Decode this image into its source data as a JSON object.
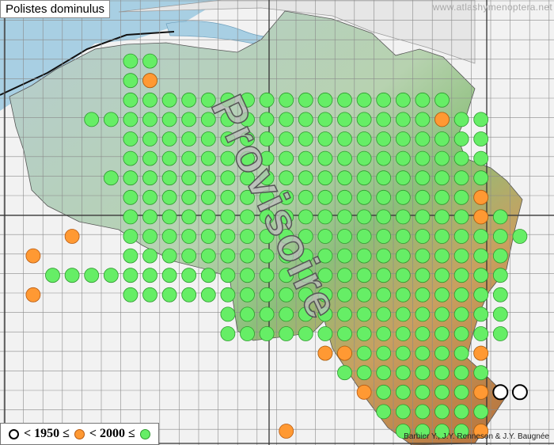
{
  "map": {
    "title": "Polistes dominulus",
    "website": "www.atlashymenoptera.net",
    "watermark": "Provisoire",
    "credit": "Barbier Y., J.Y. Renneson & J.Y. Baugnée"
  },
  "legend": {
    "label_1950": "< 1950 ≤",
    "label_2000": "< 2000 ≤"
  },
  "colors": {
    "green_record": "#66ee66",
    "orange_record": "#ff9933",
    "old_record_outline": "#000000",
    "water": "#9dc6de",
    "lowland": "#a9c4c8",
    "highland": "#c98a4e"
  },
  "records": {
    "green": [
      [
        3,
        6
      ],
      [
        3,
        7
      ],
      [
        4,
        6
      ],
      [
        4,
        7
      ],
      [
        5,
        6
      ],
      [
        5,
        7
      ],
      [
        5,
        8
      ],
      [
        5,
        9
      ],
      [
        5,
        10
      ],
      [
        5,
        11
      ],
      [
        5,
        12
      ],
      [
        5,
        13
      ],
      [
        5,
        14
      ],
      [
        5,
        15
      ],
      [
        5,
        16
      ],
      [
        5,
        17
      ],
      [
        5,
        18
      ],
      [
        5,
        19
      ],
      [
        5,
        20
      ],
      [
        5,
        21
      ],
      [
        5,
        22
      ],
      [
        6,
        4
      ],
      [
        6,
        5
      ],
      [
        6,
        6
      ],
      [
        6,
        7
      ],
      [
        6,
        8
      ],
      [
        6,
        9
      ],
      [
        6,
        10
      ],
      [
        6,
        11
      ],
      [
        6,
        12
      ],
      [
        6,
        13
      ],
      [
        6,
        14
      ],
      [
        6,
        15
      ],
      [
        6,
        16
      ],
      [
        6,
        17
      ],
      [
        6,
        18
      ],
      [
        6,
        19
      ],
      [
        6,
        20
      ],
      [
        6,
        21
      ],
      [
        6,
        22
      ],
      [
        6,
        23
      ],
      [
        6,
        24
      ],
      [
        7,
        6
      ],
      [
        7,
        7
      ],
      [
        7,
        8
      ],
      [
        7,
        9
      ],
      [
        7,
        10
      ],
      [
        7,
        11
      ],
      [
        7,
        12
      ],
      [
        7,
        13
      ],
      [
        7,
        14
      ],
      [
        7,
        15
      ],
      [
        7,
        16
      ],
      [
        7,
        17
      ],
      [
        7,
        18
      ],
      [
        7,
        19
      ],
      [
        7,
        20
      ],
      [
        7,
        21
      ],
      [
        7,
        22
      ],
      [
        7,
        23
      ],
      [
        7,
        24
      ],
      [
        8,
        6
      ],
      [
        8,
        7
      ],
      [
        8,
        8
      ],
      [
        8,
        9
      ],
      [
        8,
        10
      ],
      [
        8,
        11
      ],
      [
        8,
        12
      ],
      [
        8,
        13
      ],
      [
        8,
        14
      ],
      [
        8,
        15
      ],
      [
        8,
        16
      ],
      [
        8,
        17
      ],
      [
        8,
        18
      ],
      [
        8,
        19
      ],
      [
        8,
        20
      ],
      [
        8,
        21
      ],
      [
        8,
        22
      ],
      [
        8,
        23
      ],
      [
        8,
        24
      ],
      [
        9,
        5
      ],
      [
        9,
        6
      ],
      [
        9,
        7
      ],
      [
        9,
        8
      ],
      [
        9,
        9
      ],
      [
        9,
        10
      ],
      [
        9,
        11
      ],
      [
        9,
        12
      ],
      [
        9,
        13
      ],
      [
        9,
        14
      ],
      [
        9,
        15
      ],
      [
        9,
        16
      ],
      [
        9,
        17
      ],
      [
        9,
        18
      ],
      [
        9,
        19
      ],
      [
        9,
        20
      ],
      [
        9,
        21
      ],
      [
        9,
        22
      ],
      [
        9,
        23
      ],
      [
        9,
        24
      ],
      [
        10,
        6
      ],
      [
        10,
        7
      ],
      [
        10,
        8
      ],
      [
        10,
        9
      ],
      [
        10,
        10
      ],
      [
        10,
        11
      ],
      [
        10,
        12
      ],
      [
        10,
        13
      ],
      [
        10,
        14
      ],
      [
        10,
        15
      ],
      [
        10,
        16
      ],
      [
        10,
        17
      ],
      [
        10,
        18
      ],
      [
        10,
        19
      ],
      [
        10,
        20
      ],
      [
        10,
        21
      ],
      [
        10,
        22
      ],
      [
        10,
        23
      ],
      [
        10,
        24
      ],
      [
        11,
        6
      ],
      [
        11,
        7
      ],
      [
        11,
        8
      ],
      [
        11,
        9
      ],
      [
        11,
        10
      ],
      [
        11,
        11
      ],
      [
        11,
        12
      ],
      [
        11,
        13
      ],
      [
        11,
        14
      ],
      [
        11,
        15
      ],
      [
        11,
        16
      ],
      [
        11,
        17
      ],
      [
        11,
        18
      ],
      [
        11,
        19
      ],
      [
        11,
        20
      ],
      [
        11,
        21
      ],
      [
        11,
        22
      ],
      [
        11,
        23
      ],
      [
        11,
        24
      ],
      [
        11,
        25
      ],
      [
        12,
        6
      ],
      [
        12,
        7
      ],
      [
        12,
        8
      ],
      [
        12,
        9
      ],
      [
        12,
        10
      ],
      [
        12,
        11
      ],
      [
        12,
        12
      ],
      [
        12,
        13
      ],
      [
        12,
        14
      ],
      [
        12,
        15
      ],
      [
        12,
        16
      ],
      [
        12,
        17
      ],
      [
        12,
        18
      ],
      [
        12,
        19
      ],
      [
        12,
        20
      ],
      [
        12,
        21
      ],
      [
        12,
        22
      ],
      [
        12,
        23
      ],
      [
        12,
        24
      ],
      [
        12,
        25
      ],
      [
        12,
        26
      ],
      [
        13,
        6
      ],
      [
        13,
        7
      ],
      [
        13,
        8
      ],
      [
        13,
        9
      ],
      [
        13,
        10
      ],
      [
        13,
        11
      ],
      [
        13,
        12
      ],
      [
        13,
        13
      ],
      [
        13,
        14
      ],
      [
        13,
        15
      ],
      [
        13,
        16
      ],
      [
        13,
        17
      ],
      [
        13,
        18
      ],
      [
        13,
        19
      ],
      [
        13,
        20
      ],
      [
        13,
        21
      ],
      [
        13,
        22
      ],
      [
        13,
        23
      ],
      [
        13,
        24
      ],
      [
        13,
        25
      ],
      [
        14,
        2
      ],
      [
        14,
        3
      ],
      [
        14,
        4
      ],
      [
        14,
        5
      ],
      [
        14,
        6
      ],
      [
        14,
        7
      ],
      [
        14,
        8
      ],
      [
        14,
        9
      ],
      [
        14,
        10
      ],
      [
        14,
        11
      ],
      [
        14,
        12
      ],
      [
        14,
        13
      ],
      [
        14,
        14
      ],
      [
        14,
        15
      ],
      [
        14,
        16
      ],
      [
        14,
        17
      ],
      [
        14,
        18
      ],
      [
        14,
        19
      ],
      [
        14,
        20
      ],
      [
        14,
        21
      ],
      [
        14,
        22
      ],
      [
        14,
        23
      ],
      [
        14,
        24
      ],
      [
        14,
        25
      ],
      [
        15,
        6
      ],
      [
        15,
        7
      ],
      [
        15,
        8
      ],
      [
        15,
        9
      ],
      [
        15,
        10
      ],
      [
        15,
        11
      ],
      [
        15,
        12
      ],
      [
        15,
        13
      ],
      [
        15,
        14
      ],
      [
        15,
        15
      ],
      [
        15,
        16
      ],
      [
        15,
        17
      ],
      [
        15,
        18
      ],
      [
        15,
        19
      ],
      [
        15,
        20
      ],
      [
        15,
        21
      ],
      [
        15,
        22
      ],
      [
        15,
        23
      ],
      [
        15,
        24
      ],
      [
        15,
        25
      ],
      [
        16,
        11
      ],
      [
        16,
        12
      ],
      [
        16,
        13
      ],
      [
        16,
        14
      ],
      [
        16,
        15
      ],
      [
        16,
        16
      ],
      [
        16,
        17
      ],
      [
        16,
        18
      ],
      [
        16,
        19
      ],
      [
        16,
        20
      ],
      [
        16,
        21
      ],
      [
        16,
        22
      ],
      [
        16,
        23
      ],
      [
        16,
        24
      ],
      [
        16,
        25
      ],
      [
        17,
        11
      ],
      [
        17,
        12
      ],
      [
        17,
        13
      ],
      [
        17,
        14
      ],
      [
        17,
        15
      ],
      [
        17,
        16
      ],
      [
        17,
        17
      ],
      [
        17,
        18
      ],
      [
        17,
        19
      ],
      [
        17,
        20
      ],
      [
        17,
        21
      ],
      [
        17,
        22
      ],
      [
        17,
        23
      ],
      [
        17,
        24
      ],
      [
        17,
        25
      ],
      [
        18,
        16
      ],
      [
        18,
        17
      ],
      [
        18,
        18
      ],
      [
        18,
        19
      ],
      [
        18,
        20
      ],
      [
        18,
        21
      ],
      [
        18,
        22
      ],
      [
        18,
        23
      ],
      [
        18,
        24
      ],
      [
        19,
        17
      ],
      [
        19,
        18
      ],
      [
        19,
        19
      ],
      [
        19,
        20
      ],
      [
        19,
        21
      ],
      [
        19,
        22
      ],
      [
        19,
        23
      ],
      [
        19,
        24
      ],
      [
        20,
        19
      ],
      [
        20,
        20
      ],
      [
        20,
        21
      ],
      [
        20,
        22
      ],
      [
        20,
        23
      ],
      [
        20,
        24
      ],
      [
        21,
        19
      ],
      [
        21,
        20
      ],
      [
        21,
        21
      ],
      [
        21,
        22
      ],
      [
        21,
        23
      ],
      [
        21,
        24
      ],
      [
        22,
        20
      ],
      [
        22,
        21
      ],
      [
        22,
        22
      ],
      [
        22,
        23
      ],
      [
        22,
        24
      ],
      [
        23,
        21
      ],
      [
        23,
        22
      ],
      [
        23,
        23
      ],
      [
        23,
        24
      ],
      [
        23,
        25
      ],
      [
        24,
        22
      ],
      [
        24,
        23
      ],
      [
        24,
        24
      ],
      [
        24,
        25
      ],
      [
        25,
        25
      ],
      [
        25,
        26
      ],
      [
        25,
        24
      ]
    ],
    "orange": [
      [
        4,
        7
      ],
      [
        6,
        22
      ],
      [
        10,
        24
      ],
      [
        11,
        24
      ],
      [
        12,
        3
      ],
      [
        13,
        1
      ],
      [
        15,
        1
      ],
      [
        18,
        17
      ],
      [
        18,
        16
      ],
      [
        18,
        24
      ],
      [
        20,
        18
      ],
      [
        20,
        24
      ],
      [
        22,
        14
      ],
      [
        22,
        24
      ],
      [
        23,
        14
      ],
      [
        23,
        15
      ],
      [
        23,
        16
      ],
      [
        24,
        15
      ],
      [
        24,
        16
      ],
      [
        23,
        8
      ],
      [
        24,
        9
      ]
    ],
    "black_outline": [
      [
        20,
        25
      ],
      [
        20,
        26
      ]
    ]
  }
}
